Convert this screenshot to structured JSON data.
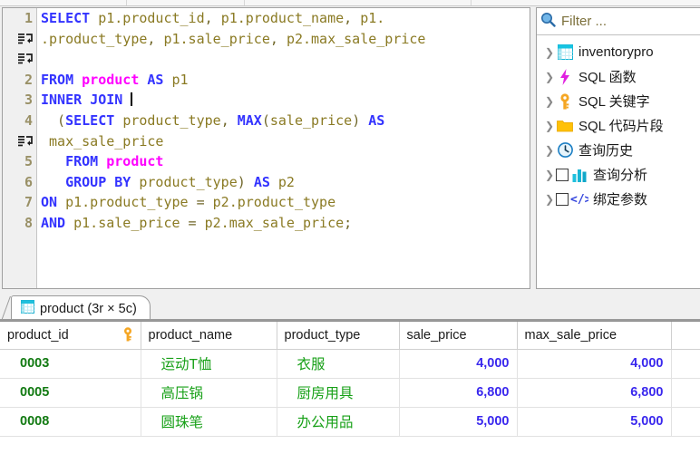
{
  "editor": {
    "lines": [
      {
        "num": "1",
        "type": "code",
        "tokens": [
          {
            "t": "SELECT",
            "c": "kw"
          },
          {
            "t": " ",
            "c": "plain"
          },
          {
            "t": "p1.product_id",
            "c": "idf"
          },
          {
            "t": ", ",
            "c": "op"
          },
          {
            "t": "p1.product_name",
            "c": "idf"
          },
          {
            "t": ", ",
            "c": "op"
          },
          {
            "t": "p1.",
            "c": "idf"
          }
        ]
      },
      {
        "num": "wrap",
        "type": "code",
        "tokens": [
          {
            "t": ".product_type",
            "c": "idf"
          },
          {
            "t": ", ",
            "c": "op"
          },
          {
            "t": "p1.sale_price",
            "c": "idf"
          },
          {
            "t": ", ",
            "c": "op"
          },
          {
            "t": "p2.max_sale_price",
            "c": "idf"
          }
        ]
      },
      {
        "num": "wrap",
        "type": "code",
        "tokens": []
      },
      {
        "num": "2",
        "type": "code",
        "tokens": [
          {
            "t": "FROM",
            "c": "kw"
          },
          {
            "t": " ",
            "c": "plain"
          },
          {
            "t": "product",
            "c": "tbl"
          },
          {
            "t": " ",
            "c": "plain"
          },
          {
            "t": "AS",
            "c": "kw"
          },
          {
            "t": " ",
            "c": "plain"
          },
          {
            "t": "p1",
            "c": "idf"
          }
        ]
      },
      {
        "num": "3",
        "type": "code",
        "caret": true,
        "tokens": [
          {
            "t": "INNER",
            "c": "kw"
          },
          {
            "t": " ",
            "c": "plain"
          },
          {
            "t": "JOIN",
            "c": "kw"
          },
          {
            "t": " ",
            "c": "plain"
          }
        ]
      },
      {
        "num": "4",
        "type": "code",
        "tokens": [
          {
            "t": "  (",
            "c": "op"
          },
          {
            "t": "SELECT",
            "c": "kw"
          },
          {
            "t": " ",
            "c": "plain"
          },
          {
            "t": "product_type",
            "c": "idf"
          },
          {
            "t": ", ",
            "c": "op"
          },
          {
            "t": "MAX",
            "c": "fn"
          },
          {
            "t": "(",
            "c": "op"
          },
          {
            "t": "sale_price",
            "c": "idf"
          },
          {
            "t": ") ",
            "c": "op"
          },
          {
            "t": "AS",
            "c": "kw"
          }
        ]
      },
      {
        "num": "wrap",
        "type": "code",
        "tokens": [
          {
            "t": " max_sale_price",
            "c": "idf"
          }
        ]
      },
      {
        "num": "5",
        "type": "code",
        "tokens": [
          {
            "t": "   ",
            "c": "plain"
          },
          {
            "t": "FROM",
            "c": "kw"
          },
          {
            "t": " ",
            "c": "plain"
          },
          {
            "t": "product",
            "c": "tbl"
          }
        ]
      },
      {
        "num": "6",
        "type": "code",
        "tokens": [
          {
            "t": "   ",
            "c": "plain"
          },
          {
            "t": "GROUP BY",
            "c": "kw"
          },
          {
            "t": " ",
            "c": "plain"
          },
          {
            "t": "product_type",
            "c": "idf"
          },
          {
            "t": ") ",
            "c": "op"
          },
          {
            "t": "AS",
            "c": "kw"
          },
          {
            "t": " ",
            "c": "plain"
          },
          {
            "t": "p2",
            "c": "idf"
          }
        ]
      },
      {
        "num": "7",
        "type": "code",
        "tokens": [
          {
            "t": "ON",
            "c": "kw"
          },
          {
            "t": " ",
            "c": "plain"
          },
          {
            "t": "p1.product_type",
            "c": "idf"
          },
          {
            "t": " = ",
            "c": "op"
          },
          {
            "t": "p2.product_type",
            "c": "idf"
          }
        ]
      },
      {
        "num": "8",
        "type": "code",
        "tokens": [
          {
            "t": "AND",
            "c": "kw"
          },
          {
            "t": " ",
            "c": "plain"
          },
          {
            "t": "p1.sale_price",
            "c": "idf"
          },
          {
            "t": " = ",
            "c": "op"
          },
          {
            "t": "p2.max_sale_price",
            "c": "idf"
          },
          {
            "t": ";",
            "c": "op"
          }
        ]
      }
    ]
  },
  "tree": {
    "filter_placeholder": "Filter ...",
    "items": [
      {
        "label": "inventorypro",
        "icon": "table-icon",
        "checkbox": false
      },
      {
        "label": "SQL 函数",
        "icon": "bolt-icon",
        "checkbox": false
      },
      {
        "label": "SQL 关键字",
        "icon": "key-icon",
        "checkbox": false
      },
      {
        "label": "SQL 代码片段",
        "icon": "folder-icon",
        "checkbox": false
      },
      {
        "label": "查询历史",
        "icon": "clock-icon",
        "checkbox": false
      },
      {
        "label": "查询分析",
        "icon": "chart-icon",
        "checkbox": true
      },
      {
        "label": "绑定参数",
        "icon": "code-icon",
        "checkbox": true
      }
    ]
  },
  "results": {
    "tab_label": "product (3r × 5c)",
    "columns": [
      "product_id",
      "product_name",
      "product_type",
      "sale_price",
      "max_sale_price"
    ],
    "rows": [
      {
        "product_id": "0003",
        "product_name": "运动T恤",
        "product_type": "衣服",
        "sale_price": "4,000",
        "max_sale_price": "4,000"
      },
      {
        "product_id": "0005",
        "product_name": "高压锅",
        "product_type": "厨房用具",
        "sale_price": "6,800",
        "max_sale_price": "6,800"
      },
      {
        "product_id": "0008",
        "product_name": "圆珠笔",
        "product_type": "办公用品",
        "sale_price": "5,000",
        "max_sale_price": "5,000"
      }
    ]
  },
  "colors": {
    "keyword": "#3333ff",
    "table": "#ff00ff",
    "identifier": "#8a7a23",
    "cell_text": "#17a017",
    "cell_number": "#3a28ee"
  }
}
